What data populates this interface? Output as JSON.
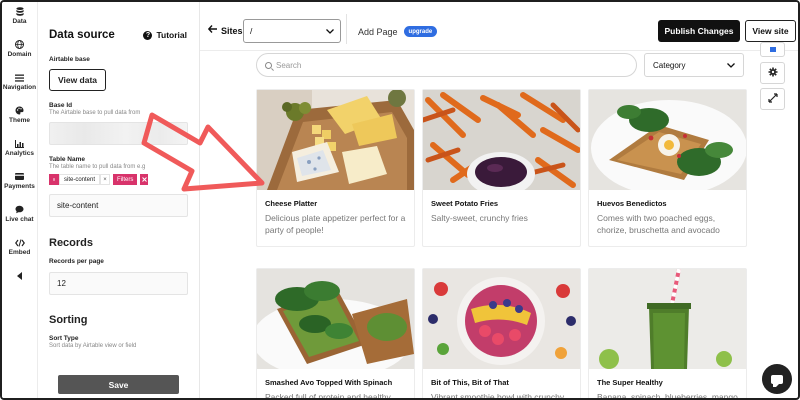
{
  "rail": {
    "items": [
      {
        "label": "Data",
        "icon": "database-icon"
      },
      {
        "label": "Domain",
        "icon": "globe-icon"
      },
      {
        "label": "Navigation",
        "icon": "menu-icon"
      },
      {
        "label": "Theme",
        "icon": "palette-icon"
      },
      {
        "label": "Analytics",
        "icon": "bar-chart-icon"
      },
      {
        "label": "Payments",
        "icon": "credit-card-icon"
      },
      {
        "label": "Live chat",
        "icon": "chat-icon"
      },
      {
        "label": "Embed",
        "icon": "code-icon"
      },
      {
        "label": "",
        "icon": "collapse-arrow-icon"
      }
    ]
  },
  "panel": {
    "title": "Data source",
    "tutorial": "Tutorial",
    "airtable_base_label": "Airtable base",
    "view_data_button": "View data",
    "base_id_label": "Base Id",
    "base_id_help": "The Airtable base to pull data from",
    "table_name_label": "Table Name",
    "table_name_help": "The table name to pull data from e.g",
    "chip_table": "site-content",
    "chip_close": "×",
    "chip_filters": "Filters",
    "table_name_value": "site-content",
    "records_title": "Records",
    "records_per_page_label": "Records per page",
    "records_per_page_value": "12",
    "sorting_title": "Sorting",
    "sort_type_label": "Sort Type",
    "sort_type_help": "Sort data by Airtable view or field",
    "save_button": "Save"
  },
  "topbar": {
    "back_label": "Sites",
    "page_select_value": "/",
    "add_page_label": "Add Page",
    "upgrade_badge": "upgrade",
    "publish_button": "Publish Changes",
    "view_site_button": "View site"
  },
  "canvas": {
    "search_placeholder": "Search",
    "category_value": "Category",
    "cards": [
      {
        "title": "Cheese Platter",
        "desc": "Delicious plate appetizer perfect for a party of people!"
      },
      {
        "title": "Sweet Potato Fries",
        "desc": "Salty-sweet, crunchy fries"
      },
      {
        "title": "Huevos Benedictos",
        "desc": "Comes with two poached eggs, chorize, bruschetta and avocado"
      },
      {
        "title": "Smashed Avo Topped With Spinach",
        "desc": "Packed full of protein and healthy fats"
      },
      {
        "title": "Bit of This, Bit of That",
        "desc": "Vibrant smoothie bowl with crunchy"
      },
      {
        "title": "The Super Healthy",
        "desc": "Banana, spinach, blueberries, mango"
      }
    ]
  },
  "colors": {
    "accent_blue": "#2f6de1",
    "chip_pink": "#d8336b",
    "annotation_red": "#f05a5a"
  }
}
